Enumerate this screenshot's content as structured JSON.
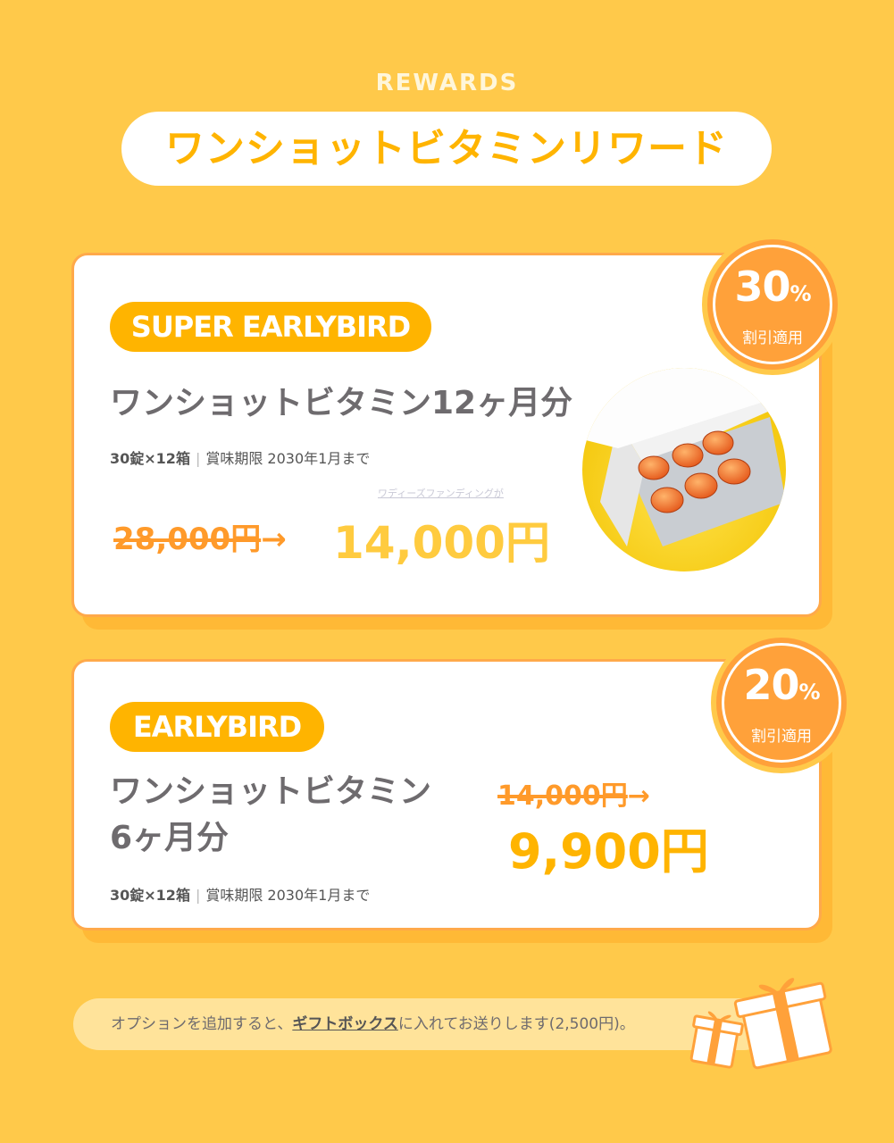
{
  "header": {
    "eyebrow": "REWARDS",
    "title": "ワンショットビタミンリワード"
  },
  "rewards": [
    {
      "tier": "SUPER EARLYBIRD",
      "product_name": "ワンショットビタミン12ヶ月分",
      "quantity": "30錠×12箱",
      "expiry": "賞味期限 2030年1月まで",
      "note": "ワディーズファンディングが",
      "original_price": "28,000円",
      "sale_price": "14,000円",
      "discount": {
        "percent": "30",
        "unit": "%",
        "label": "割引適用"
      }
    },
    {
      "tier": "EARLYBIRD",
      "product_name_line1": "ワンショットビタミン",
      "product_name_line2": "6ヶ月分",
      "quantity": "30錠×12箱",
      "expiry": "賞味期限 2030年1月まで",
      "original_price": "14,000円",
      "sale_price": "9,900円",
      "discount": {
        "percent": "20",
        "unit": "%",
        "label": "割引適用"
      }
    }
  ],
  "footer": {
    "text_before": "オプションを追加すると、",
    "link": "ギフトボックス",
    "text_after": "に入れてお送りします(2,500円)。"
  },
  "colors": {
    "background": "#ffc94a",
    "accent": "#ffb400",
    "badge": "#ffa13a",
    "strike": "#ff9a2a"
  },
  "icons": [
    "pill-blister-photo",
    "gift-box-icon"
  ]
}
